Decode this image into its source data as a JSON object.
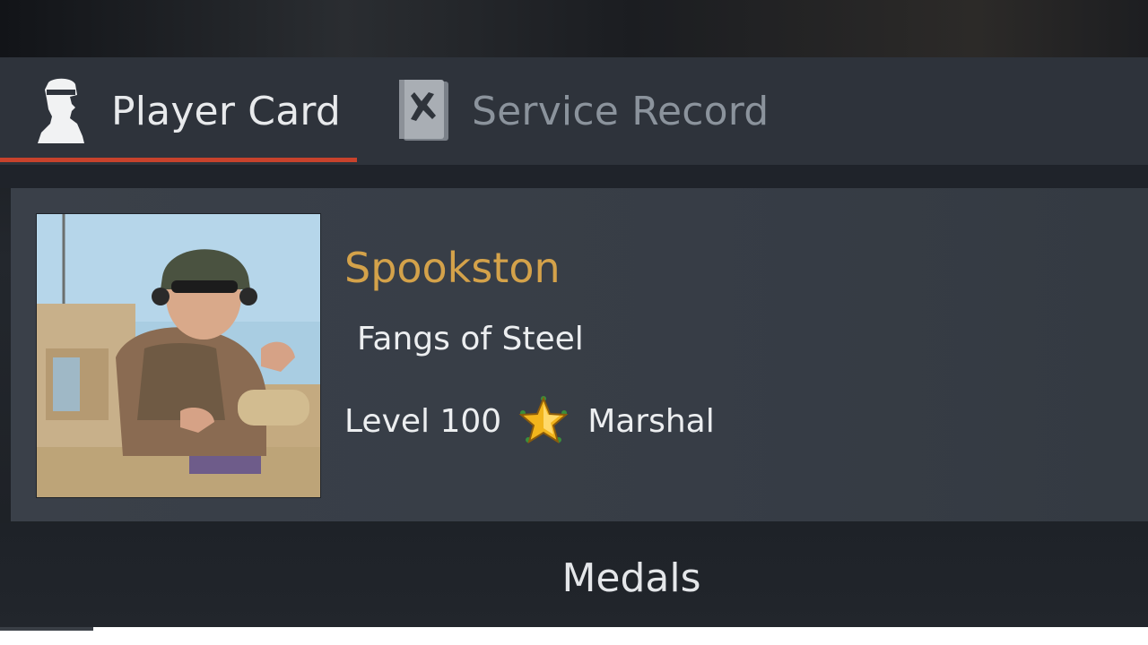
{
  "tabs": [
    {
      "label": "Player Card",
      "icon": "soldier-silhouette-icon",
      "active": true
    },
    {
      "label": "Service Record",
      "icon": "plane-book-icon",
      "active": false
    }
  ],
  "player": {
    "name": "Spookston",
    "title": "Fangs of Steel",
    "level": "Level 100",
    "rank": "Marshal",
    "rank_icon": "gold-star-icon",
    "avatar": "tank-commander-portrait"
  },
  "section": {
    "medals_label": "Medals"
  },
  "colors": {
    "name_gold": "#d4a24a",
    "active_tab_underline": "#c8422c",
    "inactive_tab_text": "#8b939c",
    "panel": "#3a4049"
  }
}
